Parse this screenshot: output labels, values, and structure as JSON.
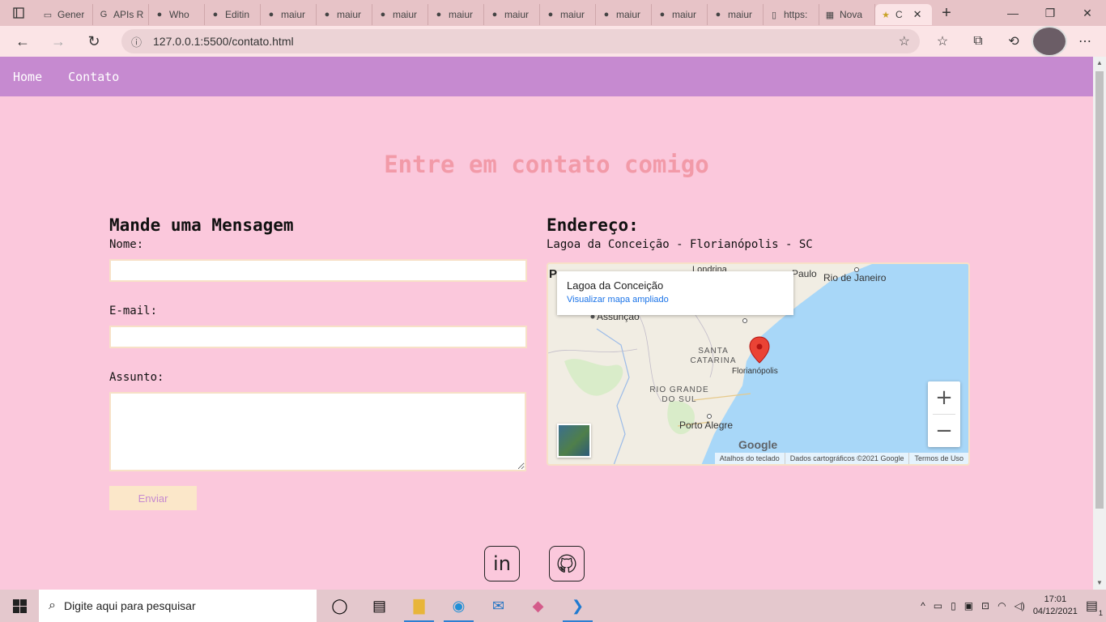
{
  "browser": {
    "tabs": [
      {
        "title": "Gener",
        "icon": "page-icon"
      },
      {
        "title": "APIs R",
        "icon": "google-icon"
      },
      {
        "title": "Who",
        "icon": "github-icon"
      },
      {
        "title": "Editin",
        "icon": "github-icon"
      },
      {
        "title": "maiur",
        "icon": "github-icon"
      },
      {
        "title": "maiur",
        "icon": "github-icon"
      },
      {
        "title": "maiur",
        "icon": "github-icon"
      },
      {
        "title": "maiur",
        "icon": "github-icon"
      },
      {
        "title": "maiur",
        "icon": "github-icon"
      },
      {
        "title": "maiur",
        "icon": "github-icon"
      },
      {
        "title": "maiur",
        "icon": "github-icon"
      },
      {
        "title": "maiur",
        "icon": "github-icon"
      },
      {
        "title": "maiur",
        "icon": "github-icon"
      },
      {
        "title": "https:",
        "icon": "document-icon"
      },
      {
        "title": "Nova",
        "icon": "newtab-icon"
      }
    ],
    "active_tab": {
      "title": "C",
      "icon": "star-icon"
    },
    "url": "127.0.0.1:5500/contato.html"
  },
  "site": {
    "nav": [
      "Home",
      "Contato"
    ],
    "title": "Entre em contato comigo",
    "form": {
      "heading": "Mande uma Mensagem",
      "name_label": "Nome:",
      "email_label": "E-mail:",
      "subject_label": "Assunto:",
      "submit_label": "Enviar"
    },
    "address": {
      "heading": "Endereço:",
      "text": "Lagoa da Conceição - Florianópolis - SC"
    },
    "map": {
      "place_name": "Lagoa da Conceição",
      "view_larger": "Visualizar mapa ampliado",
      "cities": [
        "Londrina",
        "Paulo",
        "Rio de Janeiro",
        "Assunção",
        "Florianópolis",
        "Porto Alegre"
      ],
      "regions": [
        "SANTA CATARINA",
        "RIO GRANDE DO SUL"
      ],
      "cut_label": "P",
      "logo": "Google",
      "attribution": [
        "Atalhos do teclado",
        "Dados cartográficos ©2021 Google",
        "Termos de Uso"
      ],
      "zoom_in": "+",
      "zoom_out": "−"
    },
    "social": [
      {
        "name": "linkedin-icon",
        "label": "in"
      },
      {
        "name": "github-icon"
      }
    ]
  },
  "taskbar": {
    "search_placeholder": "Digite aqui para pesquisar",
    "time": "17:01",
    "date": "04/12/2021",
    "notification_count": "1"
  }
}
